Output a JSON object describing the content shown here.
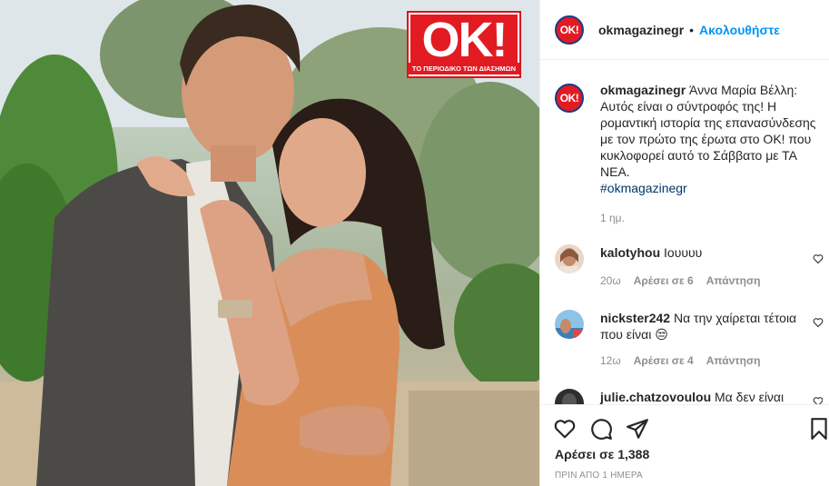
{
  "post": {
    "logo_text": "OK!",
    "logo_subtitle": "ΤΟ ΠΕΡΙΟΔΙΚΟ ΤΩΝ ΔΙΑΣΗΜΩΝ",
    "avatar_text": "OK!"
  },
  "header": {
    "username": "okmagazinegr",
    "separator": "•",
    "follow_label": "Ακολουθήστε"
  },
  "caption": {
    "username": "okmagazinegr",
    "text": "Άννα Μαρία Βέλλη: Αυτός είναι ο σύντροφός της! Η ρομαντική ιστορία της επανασύνδεσης με τον πρώτο της έρωτα στο OK! που κυκλοφορεί αυτό το Σάββατο με ΤΑ ΝΕΑ.",
    "hashtag": "#okmagazinegr",
    "time": "1 ημ."
  },
  "comments": [
    {
      "username": "kalotyhou",
      "text": "Ιουυυυ",
      "time": "20ω",
      "likes": "Αρέσει σε 6",
      "reply": "Απάντηση"
    },
    {
      "username": "nickster242",
      "text": "Να την χαίρεται τέτοια που είναι 😒",
      "time": "12ω",
      "likes": "Αρέσει σε 4",
      "reply": "Απάντηση"
    },
    {
      "username": "julie.chatzovoulou",
      "text": "Μα δεν είναι"
    }
  ],
  "footer": {
    "likes": "Αρέσει σε 1,388",
    "post_time": "ΠΡΙΝ ΑΠΟ 1 ΗΜΕΡΑ"
  },
  "icons": {
    "like": "heart-icon",
    "comment": "comment-icon",
    "share": "paper-plane-icon",
    "save": "bookmark-icon"
  },
  "colors": {
    "link_blue": "#0095f6",
    "hashtag": "#00376b",
    "ok_red": "#e21b23",
    "muted": "#8e8e8e"
  }
}
